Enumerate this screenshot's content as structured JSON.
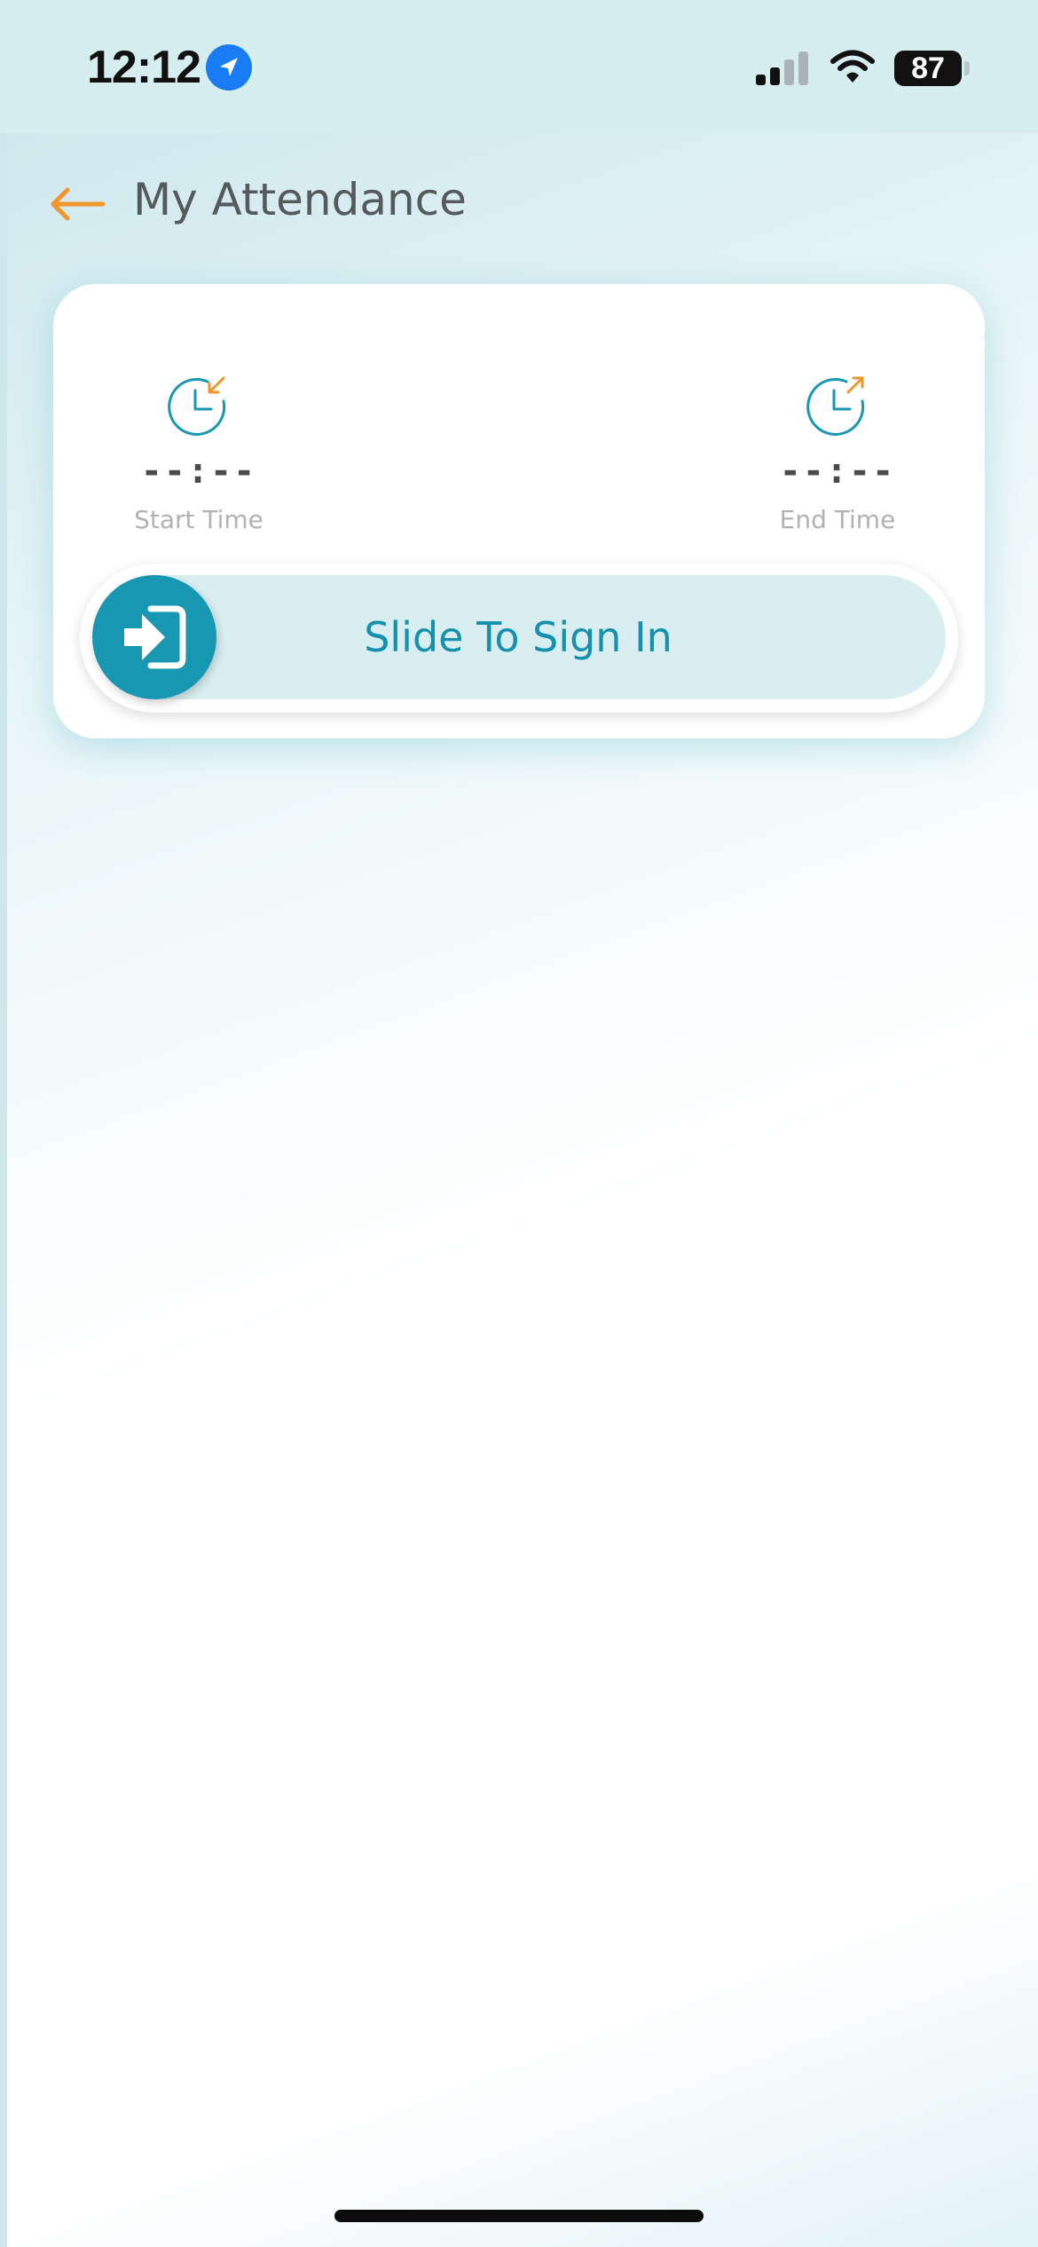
{
  "status_bar": {
    "time": "12:12",
    "battery_level": "87",
    "location_icon": "location-arrow-icon",
    "signal_icon": "cellular-signal-icon",
    "wifi_icon": "wifi-icon",
    "battery_icon": "battery-icon"
  },
  "header": {
    "title": "My Attendance",
    "back_icon": "back-arrow-icon"
  },
  "attendance_card": {
    "start": {
      "icon": "clock-in-icon",
      "value": "--:--",
      "label": "Start Time"
    },
    "end": {
      "icon": "clock-out-icon",
      "value": "--:--",
      "label": "End Time"
    },
    "slider": {
      "label": "Slide To Sign In",
      "knob_icon": "sign-in-icon",
      "progress": 0
    }
  },
  "colors": {
    "accent_orange": "#f0962a",
    "brand_teal": "#1797b2",
    "track_bg": "#d9eef1",
    "status_bar_bg": "#d7eef1",
    "title_text": "#555a5c",
    "muted_text": "#b2b2b2"
  }
}
